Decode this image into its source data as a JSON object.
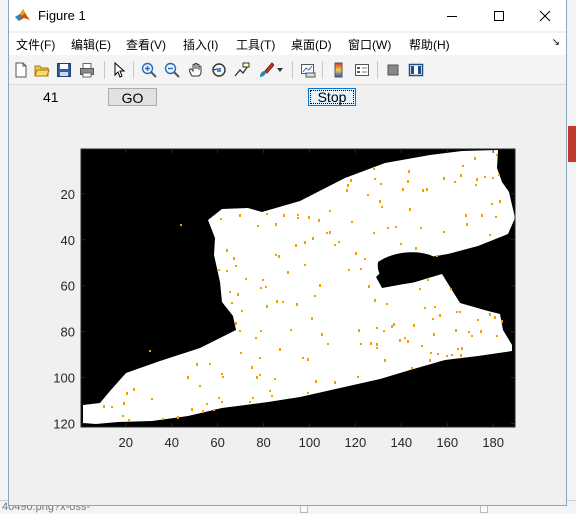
{
  "window": {
    "title": "Figure 1",
    "controls": [
      "minimize",
      "maximize",
      "close"
    ]
  },
  "menubar": {
    "items": [
      {
        "label": "文件(F)"
      },
      {
        "label": "编辑(E)"
      },
      {
        "label": "查看(V)"
      },
      {
        "label": "插入(I)"
      },
      {
        "label": "工具(T)"
      },
      {
        "label": "桌面(D)"
      },
      {
        "label": "窗口(W)"
      },
      {
        "label": "帮助(H)"
      }
    ]
  },
  "toolbar": {
    "icons": [
      "new-figure-icon",
      "open-file-icon",
      "save-icon",
      "print-icon",
      "pointer-icon",
      "zoom-in-icon",
      "zoom-out-icon",
      "pan-hand-icon",
      "rotate-3d-icon",
      "data-cursor-icon",
      "brush-icon",
      "link-plot-icon",
      "colorbar-icon",
      "legend-icon",
      "hide-plot-tools-icon",
      "show-plot-tools-icon"
    ]
  },
  "controls": {
    "value_text": "41",
    "go_label": "GO",
    "stop_label": "Stop"
  },
  "axes": {
    "xlim": [
      0.5,
      189.5
    ],
    "ylim": [
      0.5,
      121.5
    ],
    "x_ticks": [
      "20",
      "40",
      "60",
      "80",
      "100",
      "120",
      "140",
      "160",
      "180"
    ],
    "y_ticks": [
      "20",
      "40",
      "60",
      "80",
      "100",
      "120"
    ],
    "y_reversed": true
  },
  "image": {
    "background_color": "#000000",
    "region_color": "#ffffff",
    "speck_color": "#f0a000"
  },
  "background": {
    "url_fragment": "40490.png?x-oss-"
  }
}
